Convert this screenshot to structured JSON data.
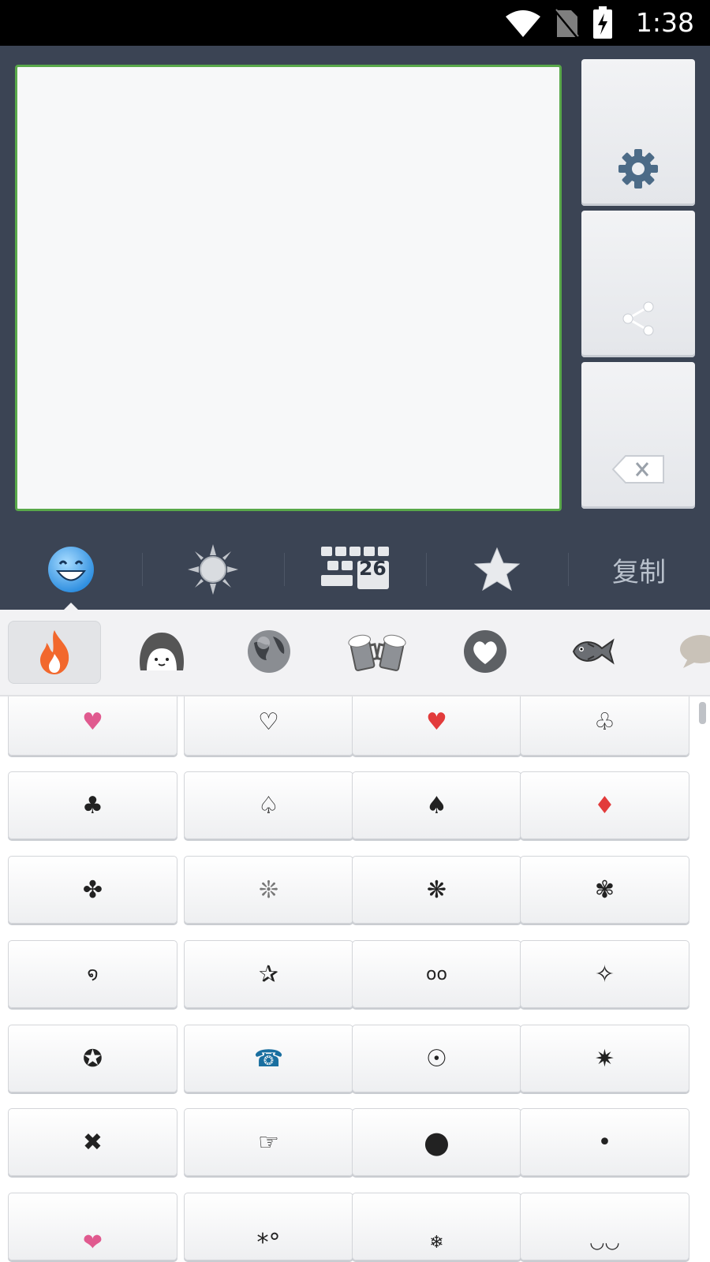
{
  "status_bar": {
    "time": "1:38"
  },
  "composer": {
    "text": ""
  },
  "sidebar": {
    "buttons": [
      {
        "icon": "gear-icon"
      },
      {
        "icon": "share-icon"
      },
      {
        "icon": "backspace-icon"
      }
    ]
  },
  "toolbar": {
    "tabs": [
      {
        "icon": "smiley-icon",
        "selected": true
      },
      {
        "icon": "sun-icon"
      },
      {
        "icon": "keyboard-26-icon",
        "badge": "26"
      },
      {
        "icon": "star-icon"
      }
    ],
    "copy_label": "复制"
  },
  "categories": [
    {
      "icon": "fire-icon",
      "selected": true
    },
    {
      "icon": "girl-face-icon"
    },
    {
      "icon": "globe-icon"
    },
    {
      "icon": "beer-mugs-icon"
    },
    {
      "icon": "heart-ring-icon"
    },
    {
      "icon": "fish-icon"
    },
    {
      "icon": "speech-bubble-icon"
    }
  ],
  "symbols": [
    [
      "♥",
      "♡",
      "♥",
      "♧"
    ],
    [
      "♣",
      "♤",
      "♠",
      "♦"
    ],
    [
      "✤",
      "❊",
      "❋",
      "✾"
    ],
    [
      "໑",
      "✰",
      "oo",
      "✧"
    ],
    [
      "✪",
      "☎",
      "☉",
      "✷"
    ],
    [
      "✖",
      "☞",
      "●",
      "•"
    ],
    [
      "❤",
      "*°",
      "❄",
      "◡◡"
    ]
  ],
  "colors": {
    "pink": "#e05a8f",
    "red": "#e23b3b",
    "phone_blue": "#1a6fa0",
    "frame_green": "#59a84a",
    "panel_dark": "#3b4454"
  }
}
